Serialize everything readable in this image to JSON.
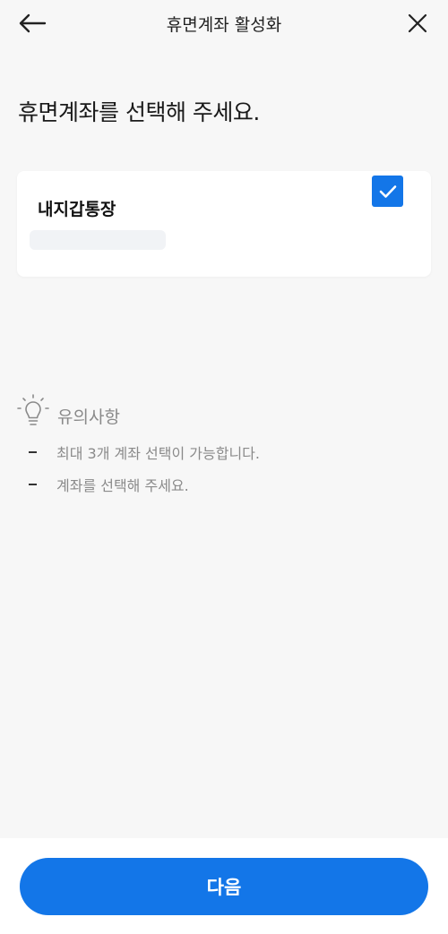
{
  "header": {
    "title": "휴면계좌 활성화",
    "back_icon": "arrow-left-icon",
    "close_icon": "close-icon"
  },
  "page_heading": "휴면계좌를 선택해 주세요.",
  "accounts": [
    {
      "name": "내지갑통장",
      "selected": true,
      "number_masked": true
    }
  ],
  "notice": {
    "icon": "lightbulb-icon",
    "title": "유의사항",
    "items": [
      "최대 3개 계좌 선택이 가능합니다.",
      "계좌를 선택해 주세요."
    ]
  },
  "next_button": {
    "label": "다음"
  },
  "colors": {
    "accent": "#1376e8",
    "background": "#f7f7f7",
    "card": "#ffffff",
    "muted_text": "#8a8a8a"
  }
}
